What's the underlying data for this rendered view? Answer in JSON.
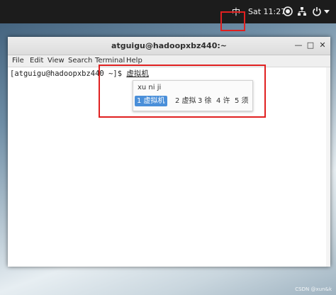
{
  "topbar": {
    "input_indicator": "中",
    "clock": "Sat 11:27",
    "icons": [
      "accessibility-icon",
      "network-icon",
      "power-icon"
    ]
  },
  "window": {
    "title": "atguigu@hadoopxbz440:~",
    "minimize_glyph": "—",
    "maximize_glyph": "□",
    "close_glyph": "✕"
  },
  "menu": {
    "items": [
      "File",
      "Edit",
      "View",
      "Search",
      "Terminal",
      "Help"
    ]
  },
  "terminal": {
    "prompt": "[atguigu@hadoopxbz440 ~]$ ",
    "preedit": "虚拟机"
  },
  "ime": {
    "pinyin": "xu ni ji",
    "candidates": [
      "1 虚拟机",
      "2 虚拟",
      "3 徐",
      "4 许",
      "5 须"
    ],
    "selected_index": 0
  },
  "watermark": "CSDN @xun&k"
}
